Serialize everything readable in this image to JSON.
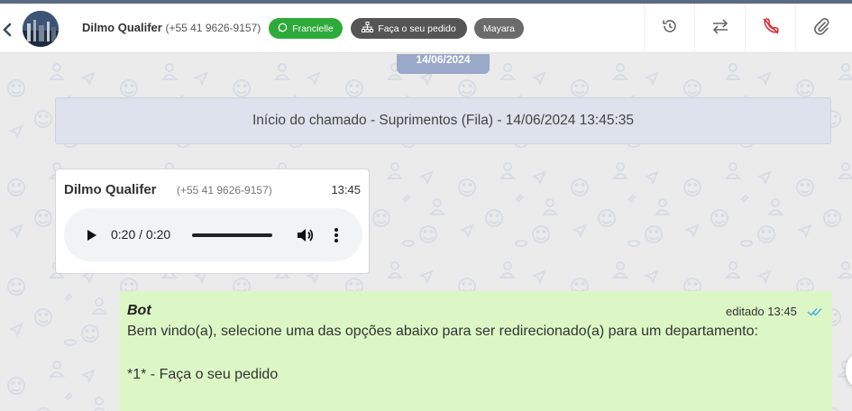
{
  "header": {
    "contact_name": "Dilmo Qualifer",
    "contact_phone": "(+55 41 9626-9157)",
    "tags": [
      {
        "label": "Francielle",
        "color": "#2eaa3a",
        "icon": "whatsapp-icon"
      },
      {
        "label": "Faça o seu pedido",
        "color": "#555555",
        "icon": "sitemap-icon"
      },
      {
        "label": "Mayara",
        "color": "#6b6b6b"
      }
    ],
    "actions": [
      {
        "icon": "history-icon"
      },
      {
        "icon": "transfer-icon"
      },
      {
        "icon": "end-call-icon",
        "color": "#d9343b"
      },
      {
        "icon": "paperclip-icon"
      }
    ]
  },
  "chat": {
    "date_chip": "14/06/2024",
    "ticket_notice": "Início do chamado - Suprimentos (Fila) - 14/06/2024 13:45:35",
    "audio_message": {
      "sender": "Dilmo Qualifer",
      "sender_phone": "(+55 41 9626-9157)",
      "time": "13:45",
      "player_time": "0:20 / 0:20",
      "progress": 1.0
    },
    "bot_message": {
      "sender": "Bot",
      "status": "editado 13:45",
      "tick_color": "#4fb0e8",
      "line1": "Bem vindo(a), selecione uma das opções abaixo para ser redirecionado(a) para um departamento:",
      "line2": "*1* - Faça o seu pedido"
    }
  }
}
